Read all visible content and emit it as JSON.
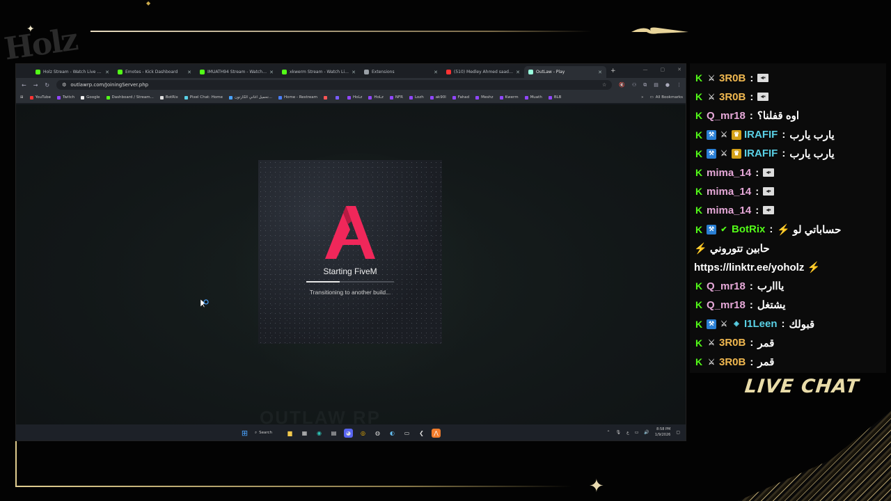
{
  "overlay": {
    "logo_text": "Holz",
    "live_chat_label": "LIVE CHAT"
  },
  "browser": {
    "tabs": [
      {
        "label": "Holz Stream - Watch Live on Kick",
        "color": "#53fc18",
        "active": false
      },
      {
        "label": "Emotes - Kick Dashboard",
        "color": "#53fc18",
        "active": false
      },
      {
        "label": "IMUATH94 Stream - Watch Live",
        "color": "#53fc18",
        "active": false
      },
      {
        "label": "xkwerm Stream - Watch Live on Kick",
        "color": "#53fc18",
        "active": false
      },
      {
        "label": "Extensions",
        "color": "#9aa0a6",
        "active": false
      },
      {
        "label": "(510) Medley Ahmed saad FT K",
        "color": "#ff3333",
        "active": false
      },
      {
        "label": "OutLaw - Play",
        "color": "#9fd",
        "active": true
      }
    ],
    "url": "outlawrp.com/JoiningServer.php",
    "bookmarks": [
      {
        "label": "YouTube",
        "color": "#ff3333"
      },
      {
        "label": "Twitch",
        "color": "#9146ff"
      },
      {
        "label": "Google",
        "color": "#eeeeee"
      },
      {
        "label": "Dashboard / Stream...",
        "color": "#53fc18"
      },
      {
        "label": "BotRix",
        "color": "#dddddd"
      },
      {
        "label": "Pixel Chat: Home",
        "color": "#5ad1e6"
      },
      {
        "label": "تحميل اغاني الكارتون...",
        "color": "#4aa3ff"
      },
      {
        "label": "Home - Restream",
        "color": "#4a7fff"
      },
      {
        "label": "",
        "color": "#ff5555"
      },
      {
        "label": "",
        "color": "#7a5cff"
      },
      {
        "label": "HoLz",
        "color": "#9146ff"
      },
      {
        "label": "HoLz",
        "color": "#9146ff"
      },
      {
        "label": "NFR",
        "color": "#9146ff"
      },
      {
        "label": "Lozh",
        "color": "#9146ff"
      },
      {
        "label": "ak90l",
        "color": "#9146ff"
      },
      {
        "label": "Fahad",
        "color": "#9146ff"
      },
      {
        "label": "Meshz",
        "color": "#9146ff"
      },
      {
        "label": "Kwerm",
        "color": "#9146ff"
      },
      {
        "label": "Muath",
        "color": "#9146ff"
      },
      {
        "label": "BLB",
        "color": "#9146ff"
      }
    ],
    "all_bookmarks": "All Bookmarks"
  },
  "loader": {
    "title": "Starting FiveM",
    "subtitle": "Transitioning to another build...",
    "progress": 0.38,
    "watermark": "OUTLAW RP"
  },
  "taskbar": {
    "search_label": "Search",
    "time": "8:58 PM",
    "date": "1/9/2026",
    "lang": "ع"
  },
  "chat": [
    {
      "badges": [
        "kick",
        "sword"
      ],
      "user": "3R0B",
      "color": "#f0b850",
      "msg": "",
      "emote": true
    },
    {
      "badges": [
        "kick",
        "sword"
      ],
      "user": "3R0B",
      "color": "#f0b850",
      "msg": "",
      "emote": true
    },
    {
      "badges": [
        "kick"
      ],
      "user": "Q_mr18",
      "color": "#e6a8d8",
      "msg": "اوه قفلنا؟",
      "emote": false
    },
    {
      "badges": [
        "kick",
        "blue",
        "sword",
        "crown"
      ],
      "user": "IRAFIF",
      "color": "#5ad1e6",
      "msg": "يارب يارب",
      "emote": false
    },
    {
      "badges": [
        "kick",
        "blue",
        "sword",
        "crown"
      ],
      "user": "IRAFIF",
      "color": "#5ad1e6",
      "msg": "يارب يارب",
      "emote": false
    },
    {
      "badges": [
        "kick"
      ],
      "user": "mima_14",
      "color": "#e6a8d8",
      "msg": "",
      "emote": true
    },
    {
      "badges": [
        "kick"
      ],
      "user": "mima_14",
      "color": "#e6a8d8",
      "msg": "",
      "emote": true
    },
    {
      "badges": [
        "kick"
      ],
      "user": "mima_14",
      "color": "#e6a8d8",
      "msg": "",
      "emote": true
    },
    {
      "badges": [
        "kick",
        "blue",
        "verified"
      ],
      "user": "BotRix",
      "color": "#53fc18",
      "msg": "⚡ حساباتي لو",
      "emote": false
    },
    {
      "badges": [],
      "user": "",
      "color": "#ffffff",
      "msg": "⚡ حابين تتوروني",
      "emote": false
    },
    {
      "badges": [],
      "user": "",
      "color": "#ffffff",
      "msg": "https://linktr.ee/yoholz ⚡",
      "emote": false
    },
    {
      "badges": [
        "kick"
      ],
      "user": "Q_mr18",
      "color": "#e6a8d8",
      "msg": "يااارب",
      "emote": false
    },
    {
      "badges": [
        "kick"
      ],
      "user": "Q_mr18",
      "color": "#e6a8d8",
      "msg": "يشتغل",
      "emote": false
    },
    {
      "badges": [
        "kick",
        "blue",
        "sword",
        "cyan"
      ],
      "user": "I1Leen",
      "color": "#5ad1e6",
      "msg": "قبولك",
      "emote": false
    },
    {
      "badges": [
        "kick",
        "sword"
      ],
      "user": "3R0B",
      "color": "#f0b850",
      "msg": "قمر",
      "emote": false
    },
    {
      "badges": [
        "kick",
        "sword"
      ],
      "user": "3R0B",
      "color": "#f0b850",
      "msg": "قمر",
      "emote": false
    }
  ]
}
